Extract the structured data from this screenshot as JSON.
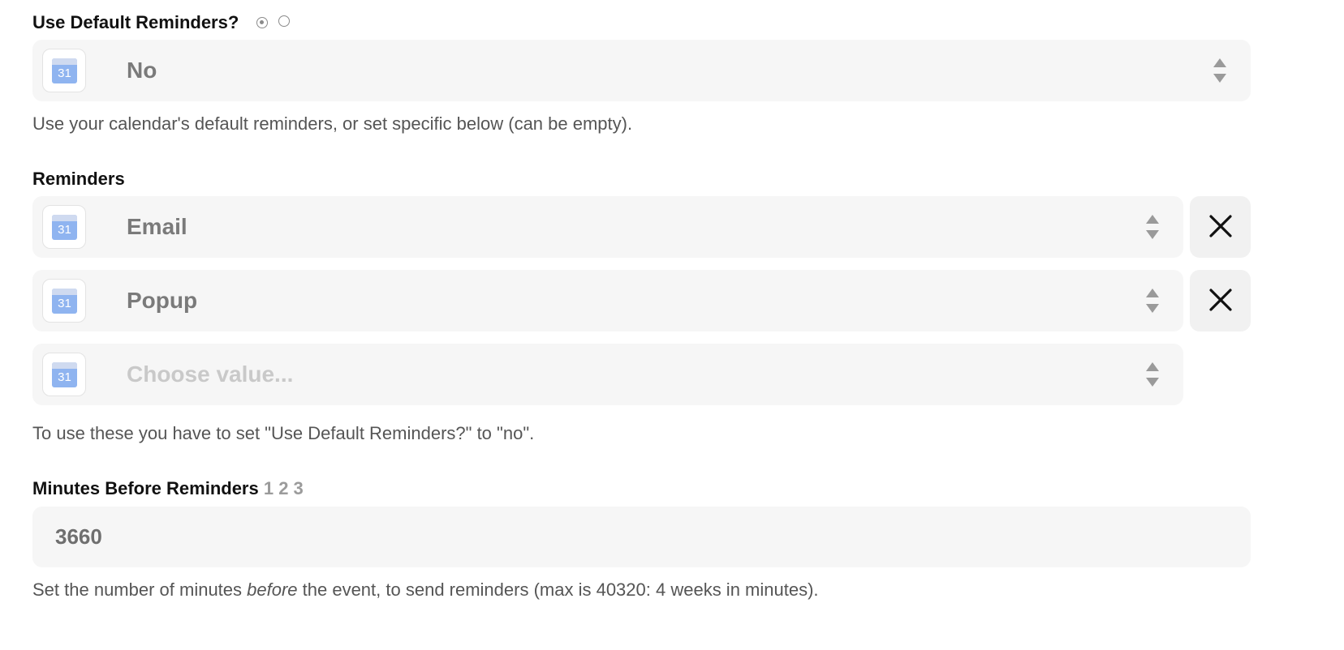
{
  "default_reminders": {
    "label": "Use Default Reminders?",
    "radio_options": [
      "selected",
      "unselected"
    ],
    "value": "No",
    "help": "Use your calendar's default reminders, or set specific below (can be empty)."
  },
  "reminders": {
    "label": "Reminders",
    "items": [
      {
        "value": "Email"
      },
      {
        "value": "Popup"
      }
    ],
    "placeholder": "Choose value...",
    "help": "To use these you have to set \"Use Default Reminders?\" to \"no\"."
  },
  "minutes": {
    "label": "Minutes Before Reminders",
    "steps": "1 2 3",
    "value": "3660",
    "help_before": "Set the number of minutes ",
    "help_emphasis": "before",
    "help_after": " the event, to send reminders (max is 40320: 4 weeks in minutes)."
  },
  "app_icon": {
    "name": "google-calendar-icon",
    "number": "31",
    "color": "#8fb4f0"
  }
}
